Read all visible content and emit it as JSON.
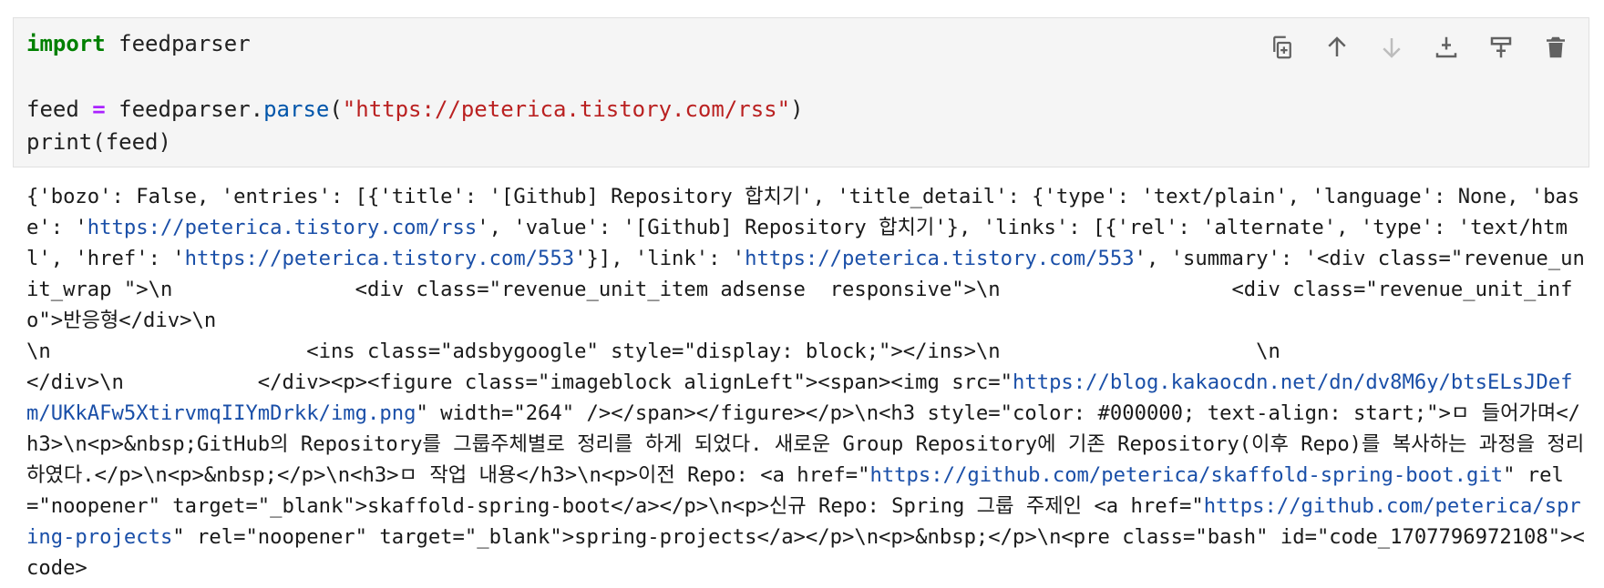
{
  "cell": {
    "code": {
      "line1_keyword": "import",
      "line1_rest": " feedparser",
      "line3_var": "feed ",
      "line3_op": "=",
      "line3_mid": " feedparser.",
      "line3_fn": "parse",
      "line3_open": "(",
      "line3_str": "\"https://peterica.tistory.com/rss\"",
      "line3_close": ")",
      "line4": "print(feed)"
    },
    "toolbar": [
      "duplicate-cell-icon",
      "move-up-icon",
      "move-down-icon",
      "insert-above-icon",
      "insert-below-icon",
      "delete-cell-icon"
    ]
  },
  "output": {
    "segments": [
      {
        "t": "{'bozo': False, 'entries': [{'title': '[Github] Repository 합치기', 'title_detail': {'type': 'text/plain', 'language': None, 'base': '"
      },
      {
        "t": "https://peterica.tistory.com/rss",
        "url": true
      },
      {
        "t": "', 'value': '[Github] Repository 합치기'}, 'links': [{'rel': 'alternate', 'type': 'text/html', 'href': '"
      },
      {
        "t": "https://peterica.tistory.com/553",
        "url": true
      },
      {
        "t": "'}], 'link': '"
      },
      {
        "t": "https://peterica.tistory.com/553",
        "url": true
      },
      {
        "t": "', 'summary': '<div class=\"revenue_unit_wrap \">\\n               <div class=\"revenue_unit_item adsense  responsive\">\\n                   <div class=\"revenue_unit_info\">반응형</div>\\n\n\\n                     <ins class=\"adsbygoogle\" style=\"display: block;\"></ins>\\n                     \\n\n</div>\\n           </div><p><figure class=\"imageblock alignLeft\"><span><img src=\""
      },
      {
        "t": "https://blog.kakaocdn.net/dn/dv8M6y/btsELsJDefm/UKkAFw5XtirvmqIIYmDrkk/img.png",
        "url": true
      },
      {
        "t": "\" width=\"264\" /></span></figure></p>\\n<h3 style=\"color: #000000; text-align: start;\">ㅁ 들어가며</h3>\\n<p>&nbsp;GitHub의 Repository를 그룹주체별로 정리를 하게 되었다. 새로운 Group Repository에 기존 Repository(이후 Repo)를 복사하는 과정을 정리하였다.</p>\\n<p>&nbsp;</p>\\n<h3>ㅁ 작업 내용</h3>\\n<p>이전 Repo: <a href=\""
      },
      {
        "t": "https://github.com/peterica/skaffold-spring-boot.git",
        "url": true
      },
      {
        "t": "\" rel=\"noopener\" target=\"_blank\">skaffold-spring-boot</a></p>\\n<p>신규 Repo: Spring 그룹 주제인 <a href=\""
      },
      {
        "t": "https://github.com/peterica/spring-projects",
        "url": true
      },
      {
        "t": "\" rel=\"noopener\" target=\"_blank\">spring-projects</a></p>\\n<p>&nbsp;</p>\\n<pre class=\"bash\" id=\"code_1707796972108\"><code>"
      }
    ]
  }
}
